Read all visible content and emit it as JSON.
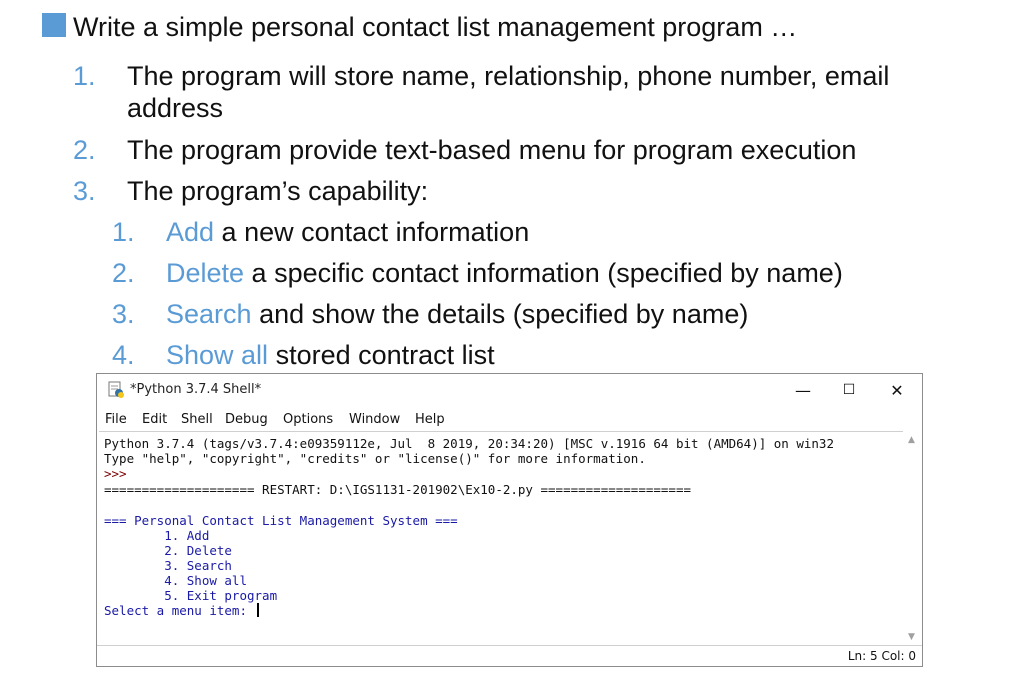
{
  "slide": {
    "intro": "Write a simple personal contact list management program …",
    "items": [
      {
        "num": "1.",
        "text": "The program will store name, relationship, phone number, email",
        "cont": "address"
      },
      {
        "num": "2.",
        "text": "The program provide text-based menu for program execution"
      },
      {
        "num": "3.",
        "text": "The program’s capability:"
      }
    ],
    "capabilities": [
      {
        "num": "1.",
        "keyword": "Add",
        "rest": " a new contact information"
      },
      {
        "num": "2.",
        "keyword": "Delete",
        "rest": " a specific contact information (specified by name)"
      },
      {
        "num": "3.",
        "keyword": "Search",
        "rest": " and show the details (specified by name)"
      },
      {
        "num": "4.",
        "keyword": "Show all",
        "rest": " stored contract list"
      }
    ],
    "accent_color": "#5b9bd5"
  },
  "window": {
    "title": "*Python 3.7.4 Shell*",
    "minimize": "—",
    "maximize": "☐",
    "close": "✕",
    "menu": [
      "File",
      "Edit",
      "Shell",
      "Debug",
      "Options",
      "Window",
      "Help"
    ],
    "shell_lines": [
      "Python 3.7.4 (tags/v3.7.4:e09359112e, Jul  8 2019, 20:34:20) [MSC v.1916 64 bit (AMD64)] on win32",
      "Type \"help\", \"copyright\", \"credits\" or \"license()\" for more information.",
      ">>> ",
      "==================== RESTART: D:\\IGS1131-201902\\Ex10-2.py ===================="
    ],
    "program_output": [
      "=== Personal Contact List Management System ===",
      "        1. Add",
      "        2. Delete",
      "        3. Search",
      "        4. Show all",
      "        5. Exit program",
      "Select a menu item: "
    ],
    "status": "Ln: 5  Col: 0"
  }
}
